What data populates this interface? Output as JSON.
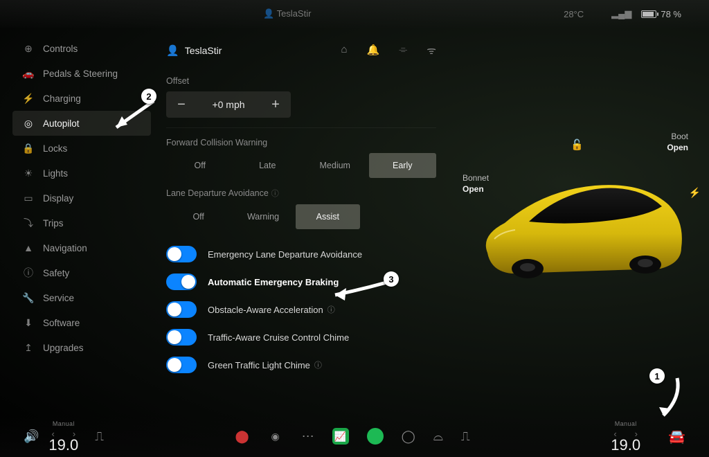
{
  "statusbar": {
    "location": "TeslaStir",
    "temp": "28°C",
    "battery_pct": "78 %"
  },
  "sidebar": {
    "items": [
      {
        "icon": "⊕",
        "label": "Controls"
      },
      {
        "icon": "🚗",
        "label": "Pedals & Steering"
      },
      {
        "icon": "⚡",
        "label": "Charging"
      },
      {
        "icon": "◎",
        "label": "Autopilot",
        "active": true
      },
      {
        "icon": "🔒",
        "label": "Locks"
      },
      {
        "icon": "☀",
        "label": "Lights"
      },
      {
        "icon": "▭",
        "label": "Display"
      },
      {
        "icon": "⤵",
        "label": "Trips"
      },
      {
        "icon": "▲",
        "label": "Navigation"
      },
      {
        "icon": "ⓘ",
        "label": "Safety"
      },
      {
        "icon": "🔧",
        "label": "Service"
      },
      {
        "icon": "⬇",
        "label": "Software"
      },
      {
        "icon": "↥",
        "label": "Upgrades"
      }
    ]
  },
  "panel": {
    "user": "TeslaStir",
    "offset_label": "Offset",
    "offset_value": "+0 mph",
    "fcw_label": "Forward Collision Warning",
    "fcw_options": [
      "Off",
      "Late",
      "Medium",
      "Early"
    ],
    "fcw_selected": 3,
    "lda_label": "Lane Departure Avoidance",
    "lda_options": [
      "Off",
      "Warning",
      "Assist"
    ],
    "lda_selected": 2,
    "toggles": [
      {
        "label": "Emergency Lane Departure Avoidance",
        "on": true,
        "knob": "left"
      },
      {
        "label": "Automatic Emergency Braking",
        "on": true,
        "hl": true,
        "knob": "right"
      },
      {
        "label": "Obstacle-Aware Acceleration",
        "on": true,
        "info": true,
        "knob": "left"
      },
      {
        "label": "Traffic-Aware Cruise Control Chime",
        "on": true,
        "knob": "left"
      },
      {
        "label": "Green Traffic Light Chime",
        "on": true,
        "info": true,
        "knob": "left"
      }
    ]
  },
  "car": {
    "bonnet_label": "Bonnet",
    "bonnet_state": "Open",
    "boot_label": "Boot",
    "boot_state": "Open"
  },
  "bottombar": {
    "climate_left_mode": "Manual",
    "climate_left_temp": "19.0",
    "climate_right_mode": "Manual",
    "climate_right_temp": "19.0"
  },
  "annotations": {
    "a1": "1",
    "a2": "2",
    "a3": "3"
  }
}
